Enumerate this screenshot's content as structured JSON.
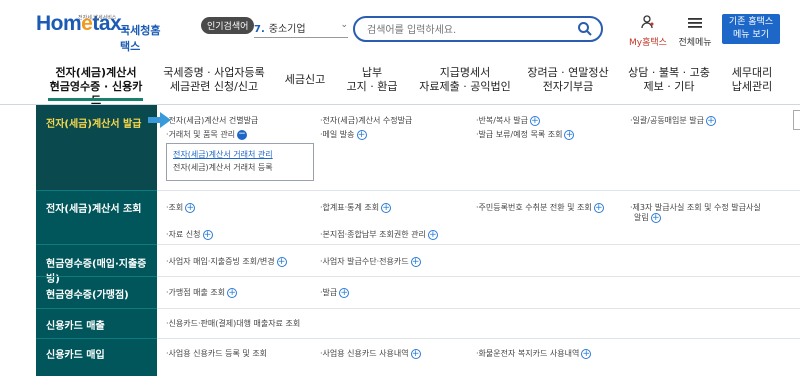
{
  "logo": {
    "mark": "Hometax",
    "mark_prefix": "Hom",
    "mark_e": "e",
    "mark_suffix": "tax.",
    "sub": "전자세 납세서비스",
    "ko": "국세청홈택스"
  },
  "popular": {
    "tag": "인기검색어",
    "rank": "7.",
    "keyword": "중소기업"
  },
  "search": {
    "placeholder": "검색어를 입력하세요."
  },
  "header_buttons": {
    "my": "My홈택스",
    "menu": "전체메뉴",
    "theme": "기존 홈택스\n메뉴 보기",
    "theme_line1": "기존 홈택스",
    "theme_line2": "메뉴 보기"
  },
  "nav": [
    {
      "l1": "전자(세금)계산서",
      "l2": "현금영수증 · 신용카드",
      "active": true
    },
    {
      "l1": "국세증명 · 사업자등록",
      "l2": "세금관련 신청/신고"
    },
    {
      "l1": "세금신고",
      "l2": ""
    },
    {
      "l1": "납부",
      "l2": "고지 · 환급"
    },
    {
      "l1": "지급명세서",
      "l2": "자료제출 · 공익법인"
    },
    {
      "l1": "장려금 · 연말정산",
      "l2": "전자기부금"
    },
    {
      "l1": "상담 · 불복 · 고충",
      "l2": "제보 · 기타"
    },
    {
      "l1": "세무대리",
      "l2": "납세관리"
    }
  ],
  "categories": [
    {
      "label": "전자(세금)계산서 발급",
      "active": true
    },
    {
      "label": "전자(세금)계산서 조회"
    },
    {
      "label": "현금영수증(매입·지출증빙)"
    },
    {
      "label": "현금영수증(가맹점)"
    },
    {
      "label": "신용카드 매출"
    },
    {
      "label": "신용카드 매입"
    }
  ],
  "row1": {
    "c1": [
      "전자(세금)계산서 건별발급",
      "거래처 및 품목 관리"
    ],
    "c2": [
      "전자(세금)계산서 수정발급",
      "메일 발송"
    ],
    "c3": [
      "반복/복사 발급",
      "발급 보류/예정 목록 조회"
    ],
    "c4": [
      "일괄/공동매입분 발급"
    ],
    "submenu": [
      "전자(세금)계산서 거래처 관리",
      "전자(세금)계산서 거래처 등록"
    ]
  },
  "row2": {
    "c1": [
      "조회",
      "자료 신청"
    ],
    "c2": [
      "합계표·통계 조회",
      "본지점·종합납부 조회권한 관리"
    ],
    "c3": [
      "주민등록번호 수취분 전환 및 조회"
    ],
    "c4a": "제3자 발급사실 조회 및 수정 발급사실",
    "c4b": "알림"
  },
  "row3": {
    "c1": "사업자 매입·지출증빙 조회/변경",
    "c2": "사업자 발급수단·전용카드"
  },
  "row4": {
    "c1": "가맹점 매출 조회",
    "c2": "발급"
  },
  "row5": {
    "c1": "신용카드·판매(결제)대행 매출자료 조회"
  },
  "row6": {
    "c1": "사업용 신용카드 등록 및 조회",
    "c2": "사업용 신용카드 사용내역",
    "c3": "화물운전자 복지카드 사용내역"
  }
}
